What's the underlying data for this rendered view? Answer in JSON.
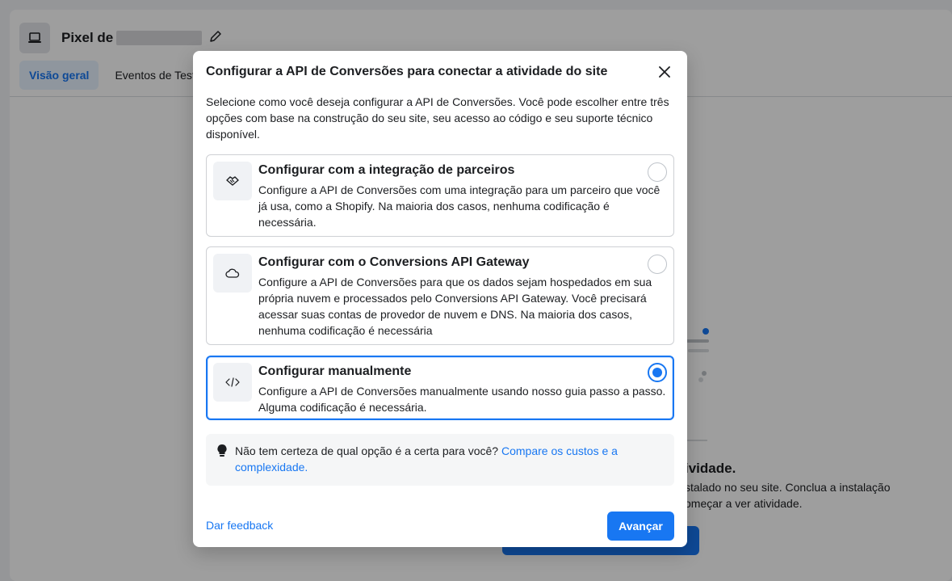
{
  "background": {
    "pixel_title": "Pixel de",
    "tabs": [
      {
        "label": "Visão geral",
        "active": true
      },
      {
        "label": "Eventos de Teste",
        "active": false
      }
    ],
    "empty_state": {
      "title_fragment": "ividade.",
      "text_line1": "stalado no seu site. Conclua a instalação",
      "text_line2": "omeçar a ver atividade."
    }
  },
  "modal": {
    "title": "Configurar a API de Conversões para conectar a atividade do site",
    "intro": "Selecione como você deseja configurar a API de Conversões. Você pode escolher entre três opções com base na construção do seu site, seu acesso ao código e seu suporte técnico disponível.",
    "options": [
      {
        "title": "Configurar com a integração de parceiros",
        "description": "Configure a API de Conversões com uma integração para um parceiro que você já usa, como a Shopify. Na maioria dos casos, nenhuma codificação é necessária.",
        "icon": "handshake-icon",
        "selected": false
      },
      {
        "title": "Configurar com o Conversions API Gateway",
        "description": "Configure a API de Conversões para que os dados sejam hospedados em sua própria nuvem e processados pelo Conversions API Gateway. Você precisará acessar suas contas de provedor de nuvem e DNS. Na maioria dos casos, nenhuma codificação é necessária",
        "icon": "cloud-icon",
        "selected": false
      },
      {
        "title": "Configurar manualmente",
        "description": "Configure a API de Conversões manualmente usando nosso guia passo a passo. Alguma codificação é necessária.",
        "icon": "code-icon",
        "selected": true
      }
    ],
    "hint": {
      "text": "Não tem certeza de qual opção é a certa para você? ",
      "link": "Compare os custos e a complexidade."
    },
    "feedback_label": "Dar feedback",
    "next_label": "Avançar"
  },
  "colors": {
    "accent": "#1877f2",
    "selected_bg": "#e7f3ff"
  }
}
